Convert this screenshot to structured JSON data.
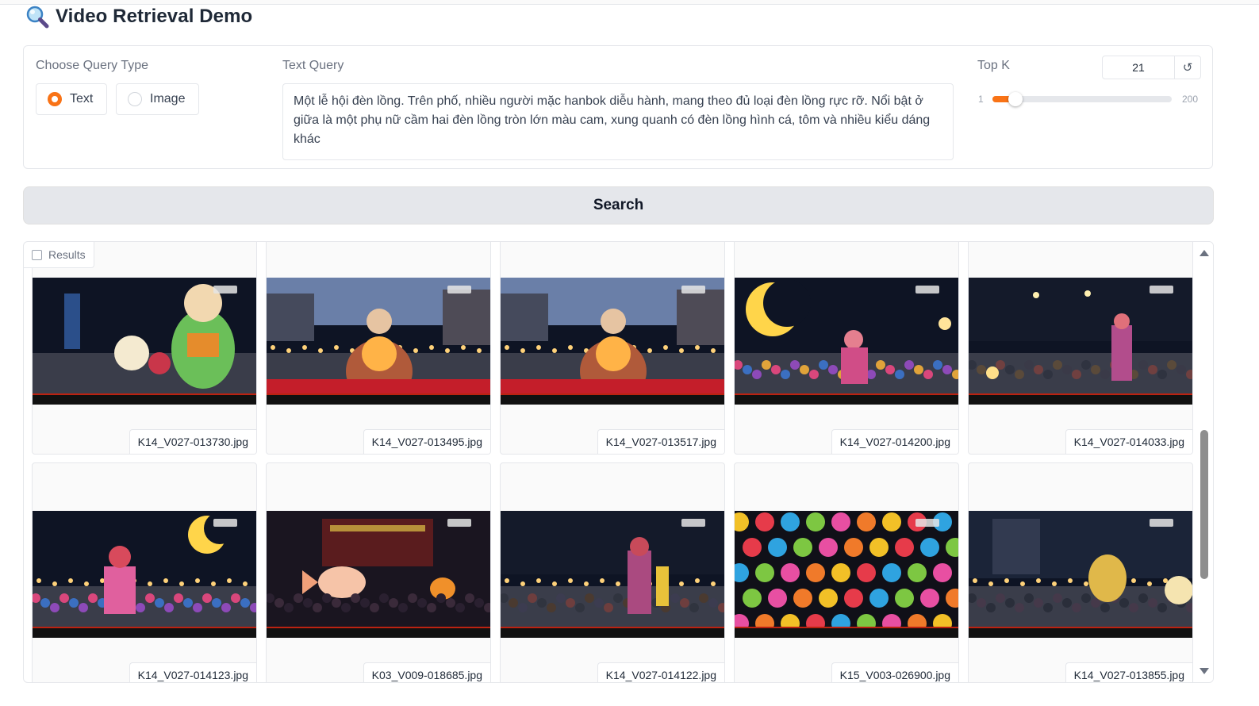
{
  "header": {
    "title": "Video Retrieval Demo",
    "icon": "magnifier-icon"
  },
  "query": {
    "type_label": "Choose Query Type",
    "options": [
      {
        "label": "Text",
        "selected": true
      },
      {
        "label": "Image",
        "selected": false
      }
    ],
    "text_label": "Text Query",
    "text_value": "Một lễ hội đèn lồng. Trên phố, nhiều người mặc hanbok diễu hành, mang theo đủ loại đèn lồng rực rỡ. Nổi bật ở giữa là một phụ nữ cầm hai đèn lồng tròn lớn màu cam, xung quanh có đèn lồng hình cá, tôm và nhiều kiểu dáng khác"
  },
  "topk": {
    "label": "Top K",
    "value": "21",
    "min": "1",
    "max": "200",
    "reset_icon": "reset-icon",
    "accent": "#f97316"
  },
  "search": {
    "label": "Search"
  },
  "results": {
    "label": "Results",
    "items": [
      {
        "filename": "K14_V027-013730.jpg",
        "scene": "buddha"
      },
      {
        "filename": "K14_V027-013495.jpg",
        "scene": "monk"
      },
      {
        "filename": "K14_V027-013517.jpg",
        "scene": "monk"
      },
      {
        "filename": "K14_V027-014200.jpg",
        "scene": "moon"
      },
      {
        "filename": "K14_V027-014033.jpg",
        "scene": "crowd"
      },
      {
        "filename": "K14_V027-014123.jpg",
        "scene": "moon2"
      },
      {
        "filename": "K03_V009-018685.jpg",
        "scene": "fish"
      },
      {
        "filename": "K14_V027-014122.jpg",
        "scene": "crowd2"
      },
      {
        "filename": "K15_V003-026900.jpg",
        "scene": "lanterns"
      },
      {
        "filename": "K14_V027-013855.jpg",
        "scene": "street"
      }
    ]
  }
}
